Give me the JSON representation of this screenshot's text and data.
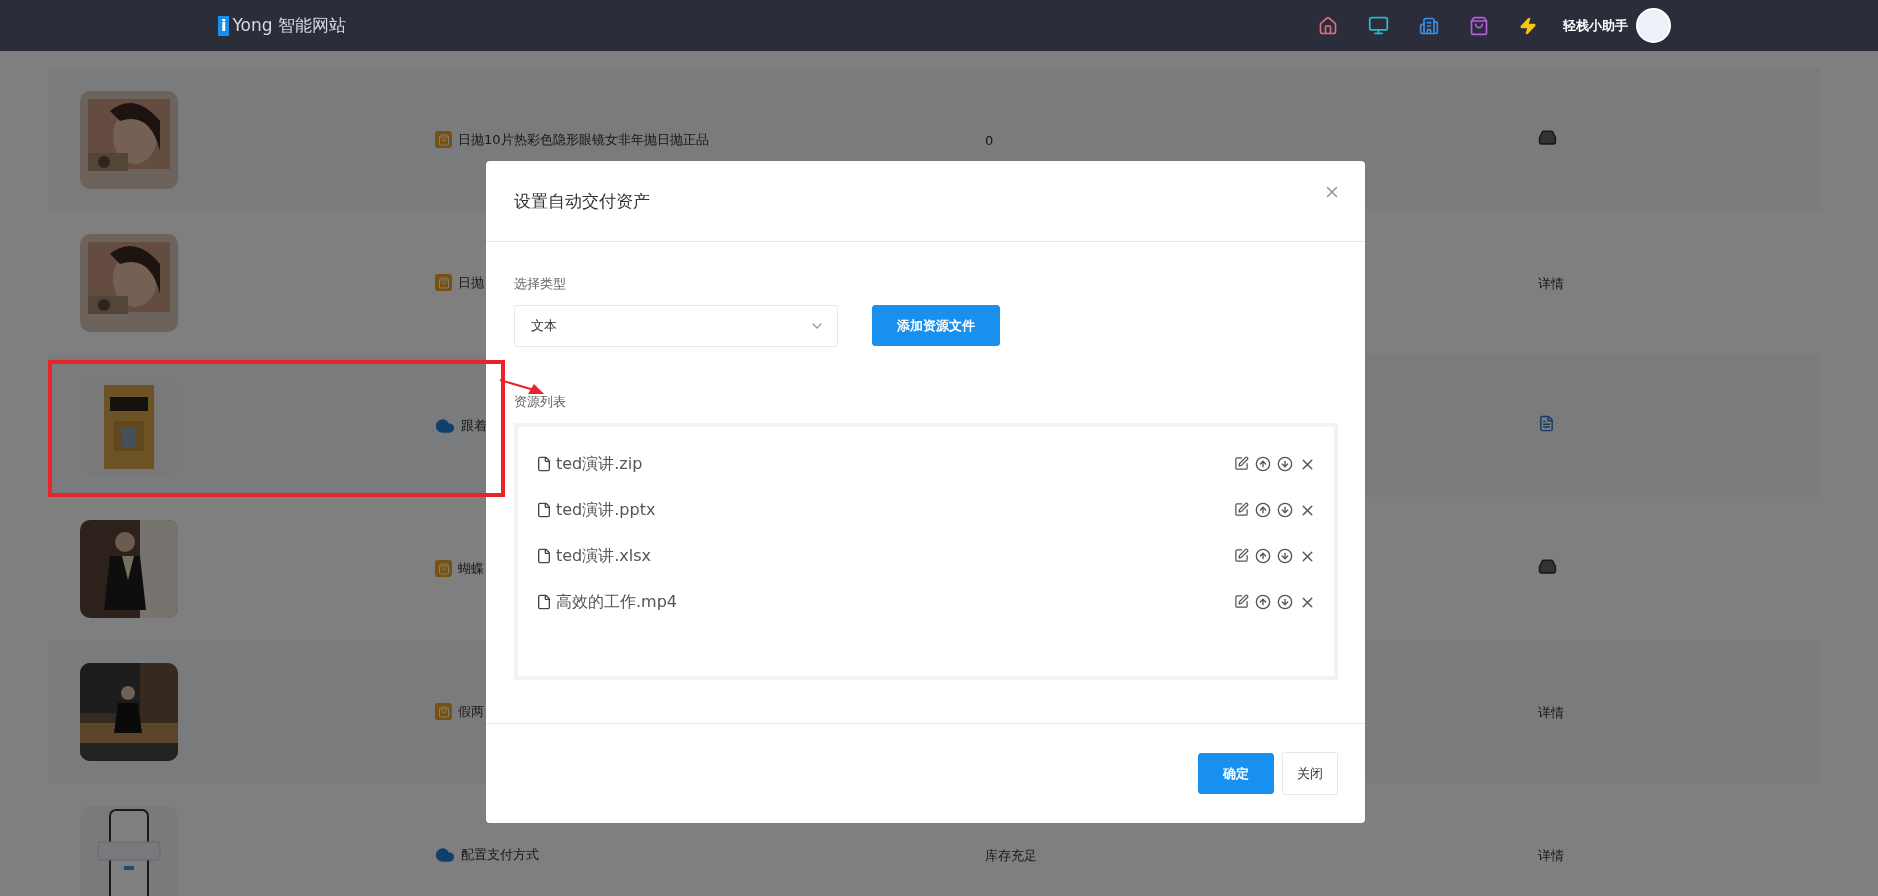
{
  "topbar": {
    "logo_mark": "i",
    "logo_text": "Yong 智能网站",
    "user_name": "轻栈小助手"
  },
  "rows": [
    {
      "kind": "bag",
      "name": "日抛10片热彩色隐形眼镜女非年抛日抛正品",
      "stock": "0",
      "action": {
        "kind": "inbox"
      }
    },
    {
      "kind": "bag",
      "name": "日抛",
      "action": {
        "kind": "link",
        "label": "详情"
      }
    },
    {
      "kind": "cloud",
      "name": "跟着",
      "action": {
        "kind": "doc"
      }
    },
    {
      "kind": "bag",
      "name": "蝴蝶",
      "action": {
        "kind": "inbox"
      }
    },
    {
      "kind": "bag",
      "name": "假两",
      "action": {
        "kind": "link",
        "label": "详情"
      }
    },
    {
      "kind": "cloud",
      "name": "配置支付方式",
      "stock": "库存充足",
      "action": {
        "kind": "link",
        "label": "详情"
      }
    }
  ],
  "dialog": {
    "title": "设置自动交付资产",
    "type_label": "选择类型",
    "type_value": "文本",
    "add_button": "添加资源文件",
    "list_label": "资源列表",
    "files": [
      {
        "name": "ted演讲.zip"
      },
      {
        "name": "ted演讲.pptx"
      },
      {
        "name": "ted演讲.xlsx"
      },
      {
        "name": "高效的工作.mp4"
      }
    ],
    "buttons": [
      {
        "label": "确定",
        "kind": "primary"
      },
      {
        "label": "关闭",
        "kind": "default"
      }
    ]
  }
}
